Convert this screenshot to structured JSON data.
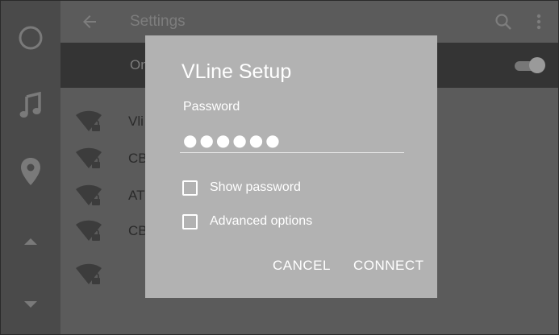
{
  "topbar": {
    "title": "Settings",
    "back_icon": "arrow-left-icon",
    "search_icon": "search-icon",
    "more_icon": "more-vert-icon"
  },
  "rail": {
    "items": [
      {
        "icon": "home-circle-icon"
      },
      {
        "icon": "music-note-icon"
      },
      {
        "icon": "location-pin-icon"
      },
      {
        "icon": "chevron-up-icon"
      },
      {
        "icon": "chevron-down-icon"
      }
    ]
  },
  "wifi_toggle": {
    "label": "On",
    "state": "on"
  },
  "networks": [
    {
      "name": "Vli",
      "icon": "wifi-lock-icon"
    },
    {
      "name": "CB",
      "icon": "wifi-lock-icon"
    },
    {
      "name": "AT",
      "icon": "wifi-lock-icon"
    },
    {
      "name": "CB",
      "icon": "wifi-lock-icon"
    },
    {
      "name": "",
      "icon": "wifi-lock-icon"
    }
  ],
  "dialog": {
    "title": "VLine Setup",
    "password_label": "Password",
    "password_value": "●●●●●●",
    "show_password_label": "Show password",
    "advanced_options_label": "Advanced options",
    "cancel_label": "CANCEL",
    "connect_label": "CONNECT"
  },
  "colors": {
    "background": "#5b5b5b",
    "rail": "#4a4a4a",
    "toggle_row": "#343434",
    "dialog": "#b2b2b2",
    "dialog_text": "#ffffff"
  }
}
